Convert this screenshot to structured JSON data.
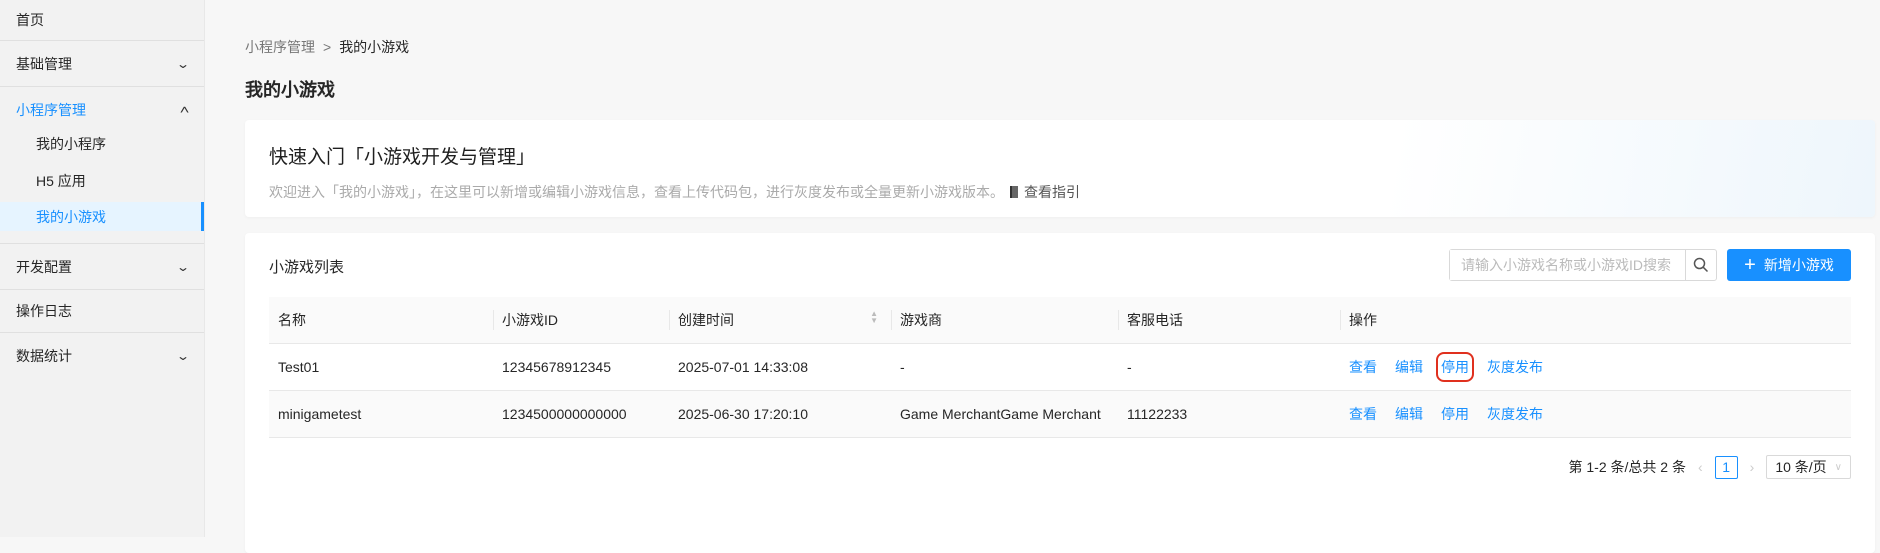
{
  "sidebar": {
    "items": [
      {
        "label": "首页"
      },
      {
        "label": "基础管理",
        "icon": "chevron-down"
      },
      {
        "label": "小程序管理",
        "icon": "chevron-up",
        "children": [
          {
            "label": "我的小程序"
          },
          {
            "label": "H5 应用"
          },
          {
            "label": "我的小游戏"
          }
        ]
      },
      {
        "label": "开发配置",
        "icon": "chevron-down"
      },
      {
        "label": "操作日志"
      },
      {
        "label": "数据统计",
        "icon": "chevron-down"
      }
    ]
  },
  "breadcrumb": {
    "parent": "小程序管理",
    "separator": ">",
    "current": "我的小游戏"
  },
  "page_title": "我的小游戏",
  "banner": {
    "title": "快速入门「小游戏开发与管理」",
    "desc": "欢迎进入「我的小游戏」，在这里可以新增或编辑小游戏信息，查看上传代码包，进行灰度发布或全量更新小游戏版本。",
    "guide": "查看指引"
  },
  "list": {
    "title": "小游戏列表",
    "search_placeholder": "请输入小游戏名称或小游戏ID搜索",
    "add_label": "新增小游戏",
    "columns": [
      "名称",
      "小游戏ID",
      "创建时间",
      "游戏商",
      "客服电话",
      "操作"
    ],
    "rows": [
      {
        "name": "Test01",
        "id": "12345678912345",
        "created": "2025-07-01 14:33:08",
        "merchant": "-",
        "phone": "-",
        "actions": [
          "查看",
          "编辑",
          "停用",
          "灰度发布"
        ]
      },
      {
        "name": "minigametest",
        "id": "1234500000000000",
        "created": "2025-06-30 17:20:10",
        "merchant": "Game MerchantGame Merchant",
        "phone": "11122233",
        "actions": [
          "查看",
          "编辑",
          "停用",
          "灰度发布"
        ]
      }
    ],
    "pagination": {
      "summary": "第 1-2 条/总共 2 条",
      "current_page": "1",
      "page_size": "10 条/页"
    }
  },
  "colors": {
    "accent": "#1890ff",
    "highlight": "#e0301e"
  }
}
